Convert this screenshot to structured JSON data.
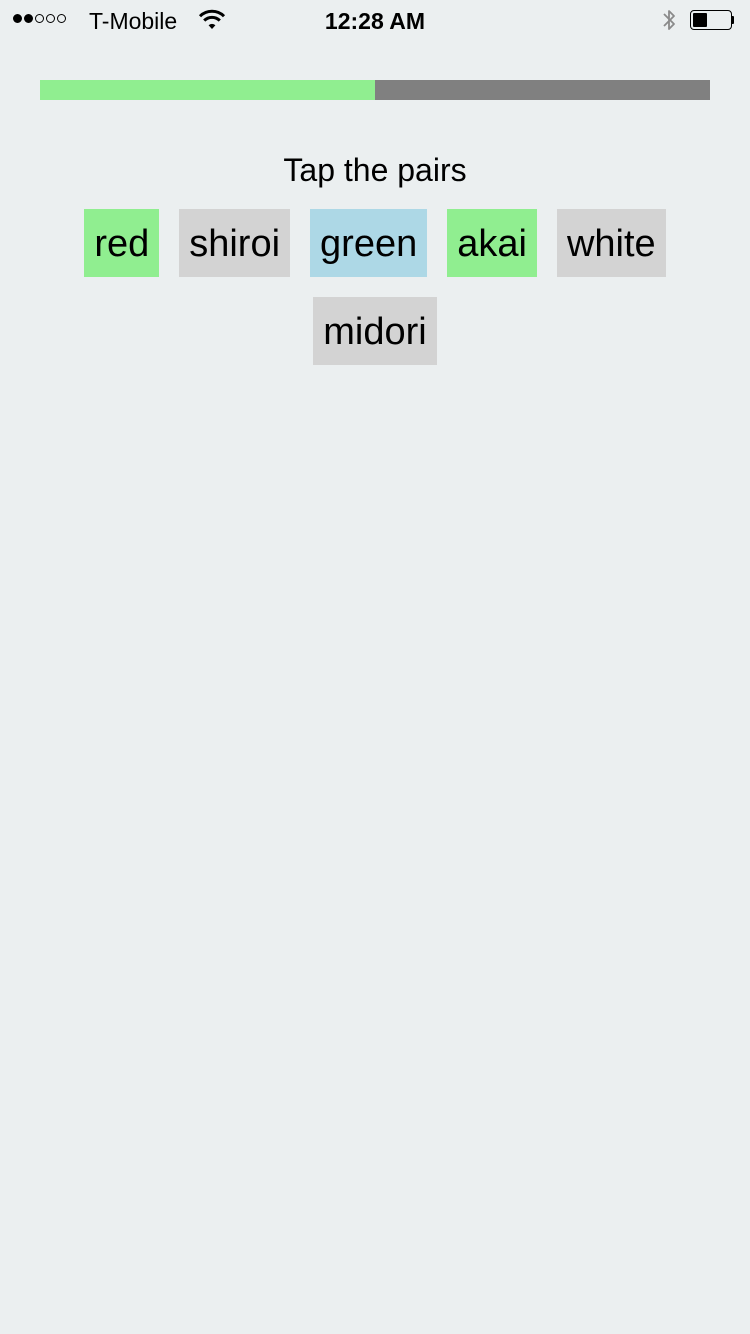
{
  "status_bar": {
    "signal_bars_filled": 2,
    "signal_bars_total": 5,
    "carrier": "T-Mobile",
    "time": "12:28 AM",
    "battery_level": 0.25,
    "icons": [
      "signal-dots-icon",
      "wifi-icon",
      "bluetooth-icon",
      "battery-icon"
    ]
  },
  "progress": {
    "value": 0.5,
    "fill_color": "#90ee90",
    "track_color": "#808080"
  },
  "prompt": "Tap the pairs",
  "tiles": [
    {
      "label": "red",
      "state": "matched",
      "color": "#90ee90"
    },
    {
      "label": "shiroi",
      "state": "default",
      "color": "#d3d3d3"
    },
    {
      "label": "green",
      "state": "selected",
      "color": "#add8e6"
    },
    {
      "label": "akai",
      "state": "matched",
      "color": "#90ee90"
    },
    {
      "label": "white",
      "state": "default",
      "color": "#d3d3d3"
    },
    {
      "label": "midori",
      "state": "default",
      "color": "#d3d3d3"
    }
  ],
  "colors": {
    "background": "#ebeff0",
    "matched": "#90ee90",
    "selected": "#add8e6",
    "default": "#d3d3d3"
  }
}
